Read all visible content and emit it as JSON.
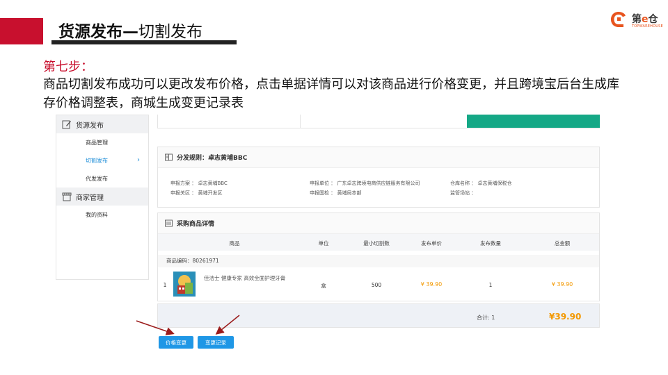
{
  "slide": {
    "title_bold": "货源发布—",
    "title_light": "切割发布",
    "step": "第七步：",
    "description": "商品切割发布成功可以更改发布价格，点击单据详情可以对该商品进行价格变更，并且跨境宝后台生成库存价格调整表，商城生成变更记录表",
    "logo_text_a": "第",
    "logo_text_e": "e",
    "logo_text_b": "仓",
    "logo_sub": "TOPWAREHOUSE",
    "accent_color": "#c8102e"
  },
  "sidebar": {
    "group1": {
      "label": "货源发布",
      "icon": "edit-icon"
    },
    "items1": [
      {
        "label": "商品管理"
      },
      {
        "label": "切割发布",
        "active": true
      },
      {
        "label": "代发发布"
      }
    ],
    "group2": {
      "label": "商家管理",
      "icon": "store-icon"
    },
    "items2": [
      {
        "label": "我的资料"
      }
    ]
  },
  "rule_panel": {
    "title": "分发规则：卓志黄埔BBC",
    "fields": {
      "declare_plan": "申报方案 ： 卓志黄埔BBC",
      "declare_customs": "申报关区 ： 黄埔开发区",
      "declare_unit": "申报单位 ： 广东卓志跨境电商供应链服务有限公司",
      "declare_inspection": "申报国检 ： 黄埔局本部",
      "warehouse": "仓库名称 ： 卓志黄埔保税仓",
      "supervision": "监管场站 ："
    }
  },
  "goods_panel": {
    "title": "采购商品详情",
    "columns": [
      "商品",
      "单位",
      "最小切割数",
      "发布单价",
      "发布数量",
      "总金额"
    ],
    "product_code": "商品编码：80261971",
    "rows": [
      {
        "index": "1",
        "name": "佳洁士 健康专家 高效全面护理牙膏",
        "unit": "盒",
        "min_cut": "500",
        "unit_price": "¥ 39.90",
        "quantity": "1",
        "total": "¥ 39.90"
      }
    ]
  },
  "total": {
    "label": "合计: 1",
    "value": "¥39.90"
  },
  "buttons": {
    "price_change": "价格变更",
    "change_record": "变更记录"
  },
  "colors": {
    "primary_blue": "#1f97e6",
    "price_orange": "#f39800",
    "green_banner": "#15a886"
  }
}
